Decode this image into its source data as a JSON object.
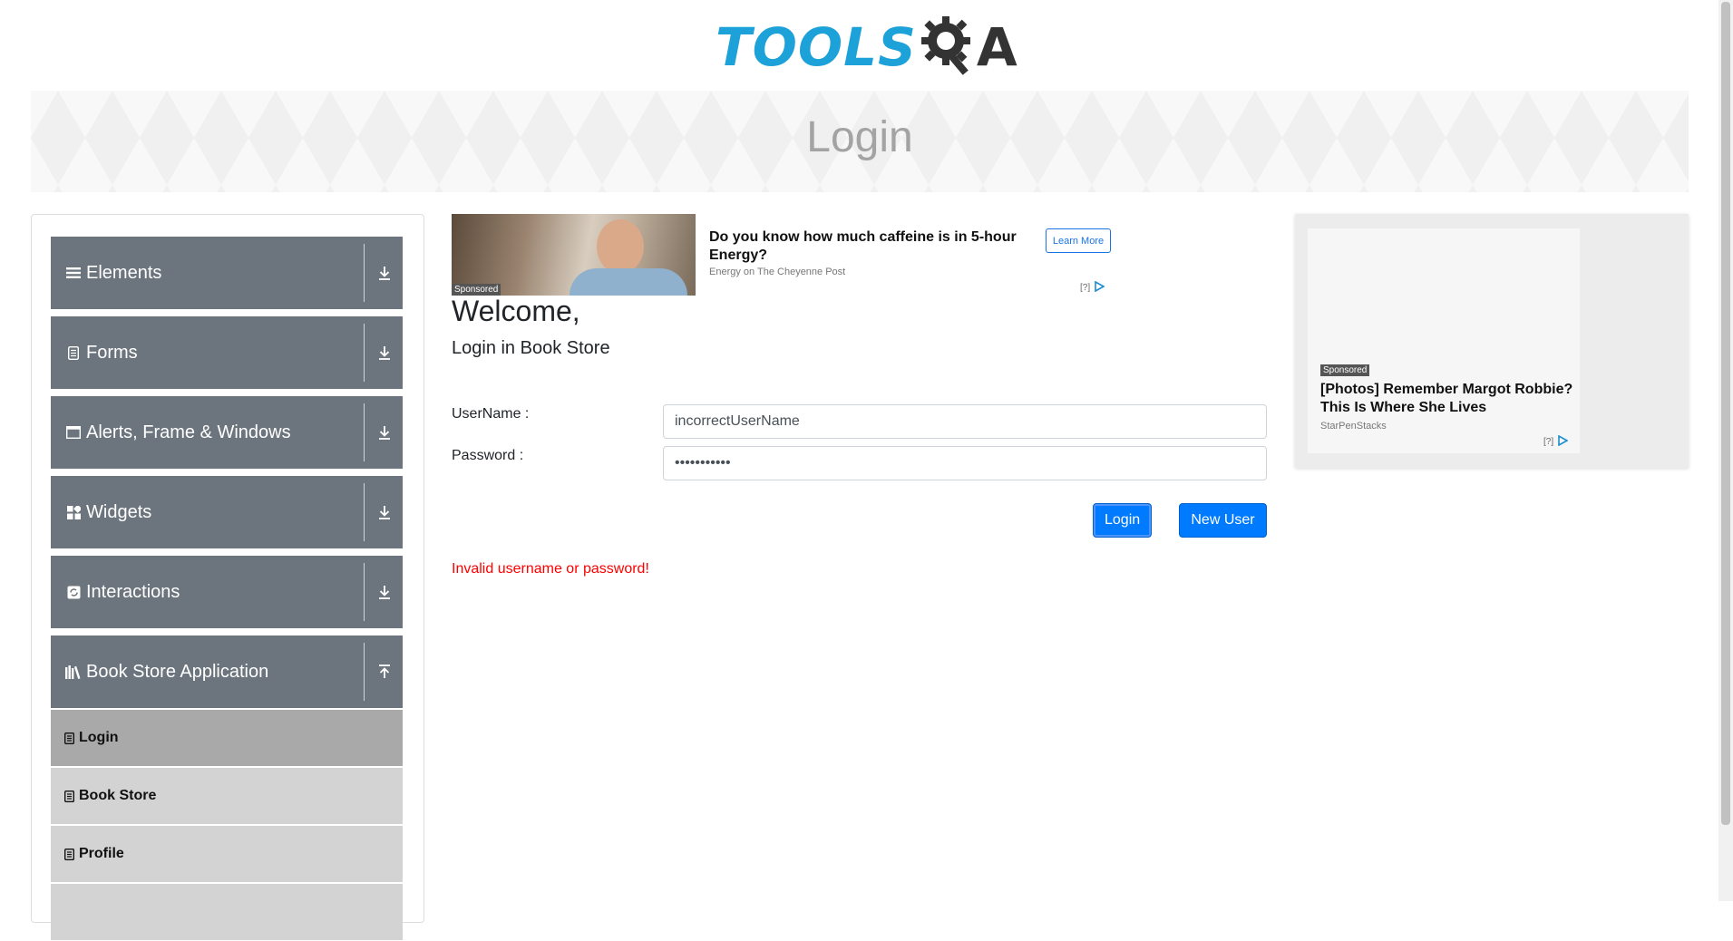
{
  "header": {
    "logo_text_1": "TOOLS",
    "logo_text_2": "A"
  },
  "banner": {
    "title": "Login"
  },
  "sidebar": {
    "groups": [
      {
        "label": "Elements",
        "icon": "list-icon",
        "expanded": false
      },
      {
        "label": "Forms",
        "icon": "document-icon",
        "expanded": false
      },
      {
        "label": "Alerts, Frame & Windows",
        "icon": "window-icon",
        "expanded": false
      },
      {
        "label": "Widgets",
        "icon": "grid-icon",
        "expanded": false
      },
      {
        "label": "Interactions",
        "icon": "refresh-icon",
        "expanded": false
      },
      {
        "label": "Book Store Application",
        "icon": "books-icon",
        "expanded": true
      }
    ],
    "book_items": [
      {
        "label": "Login",
        "active": true
      },
      {
        "label": "Book Store",
        "active": false
      },
      {
        "label": "Profile",
        "active": false
      }
    ]
  },
  "ad_top": {
    "sponsored": "Sponsored",
    "headline": "Do you know how much caffeine is in 5-hour Energy?",
    "source": "Energy on The Cheyenne Post",
    "cta": "Learn More",
    "info": "[?]"
  },
  "main": {
    "welcome": "Welcome,",
    "subtitle": "Login in Book Store",
    "username_label": "UserName :",
    "username_value": "incorrectUserName",
    "password_label": "Password :",
    "password_value": "•••••••••••",
    "login_button": "Login",
    "new_user_button": "New User",
    "error": "Invalid username or password!"
  },
  "ad_right": {
    "sponsored": "Sponsored",
    "headline": "[Photos] Remember Margot Robbie? This Is Where She Lives",
    "source": "StarPenStacks",
    "info": "[?]"
  },
  "colors": {
    "accent": "#007bff",
    "sidebar_group": "#6c757d",
    "sidebar_item": "#d3d3d3",
    "sidebar_item_active": "#a9a9a9",
    "error": "#ff0000",
    "logo_blue": "#1da1d9"
  }
}
